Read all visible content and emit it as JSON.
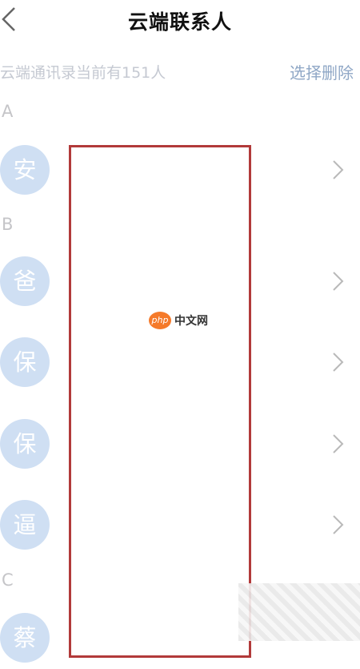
{
  "header": {
    "title": "云端联系人"
  },
  "summary": {
    "text": "云端通讯录当前有151人",
    "action_label": "选择删除"
  },
  "sections": [
    {
      "letter": "A",
      "contacts": [
        {
          "avatar_char": "安"
        }
      ]
    },
    {
      "letter": "B",
      "contacts": [
        {
          "avatar_char": "爸"
        },
        {
          "avatar_char": "保"
        },
        {
          "avatar_char": "保"
        },
        {
          "avatar_char": "逼"
        }
      ]
    },
    {
      "letter": "C",
      "contacts": [
        {
          "avatar_char": "蔡"
        }
      ]
    }
  ],
  "watermark": {
    "logo": "php",
    "text": "中文网"
  },
  "colors": {
    "avatar_bg": "#cfdff3",
    "action_text": "#8fa7c6",
    "redact_border": "#b23a3a",
    "watermark_logo": "#f57a2a"
  },
  "icons": {
    "back": "chevron-left-icon",
    "row_arrow": "chevron-right-icon"
  }
}
